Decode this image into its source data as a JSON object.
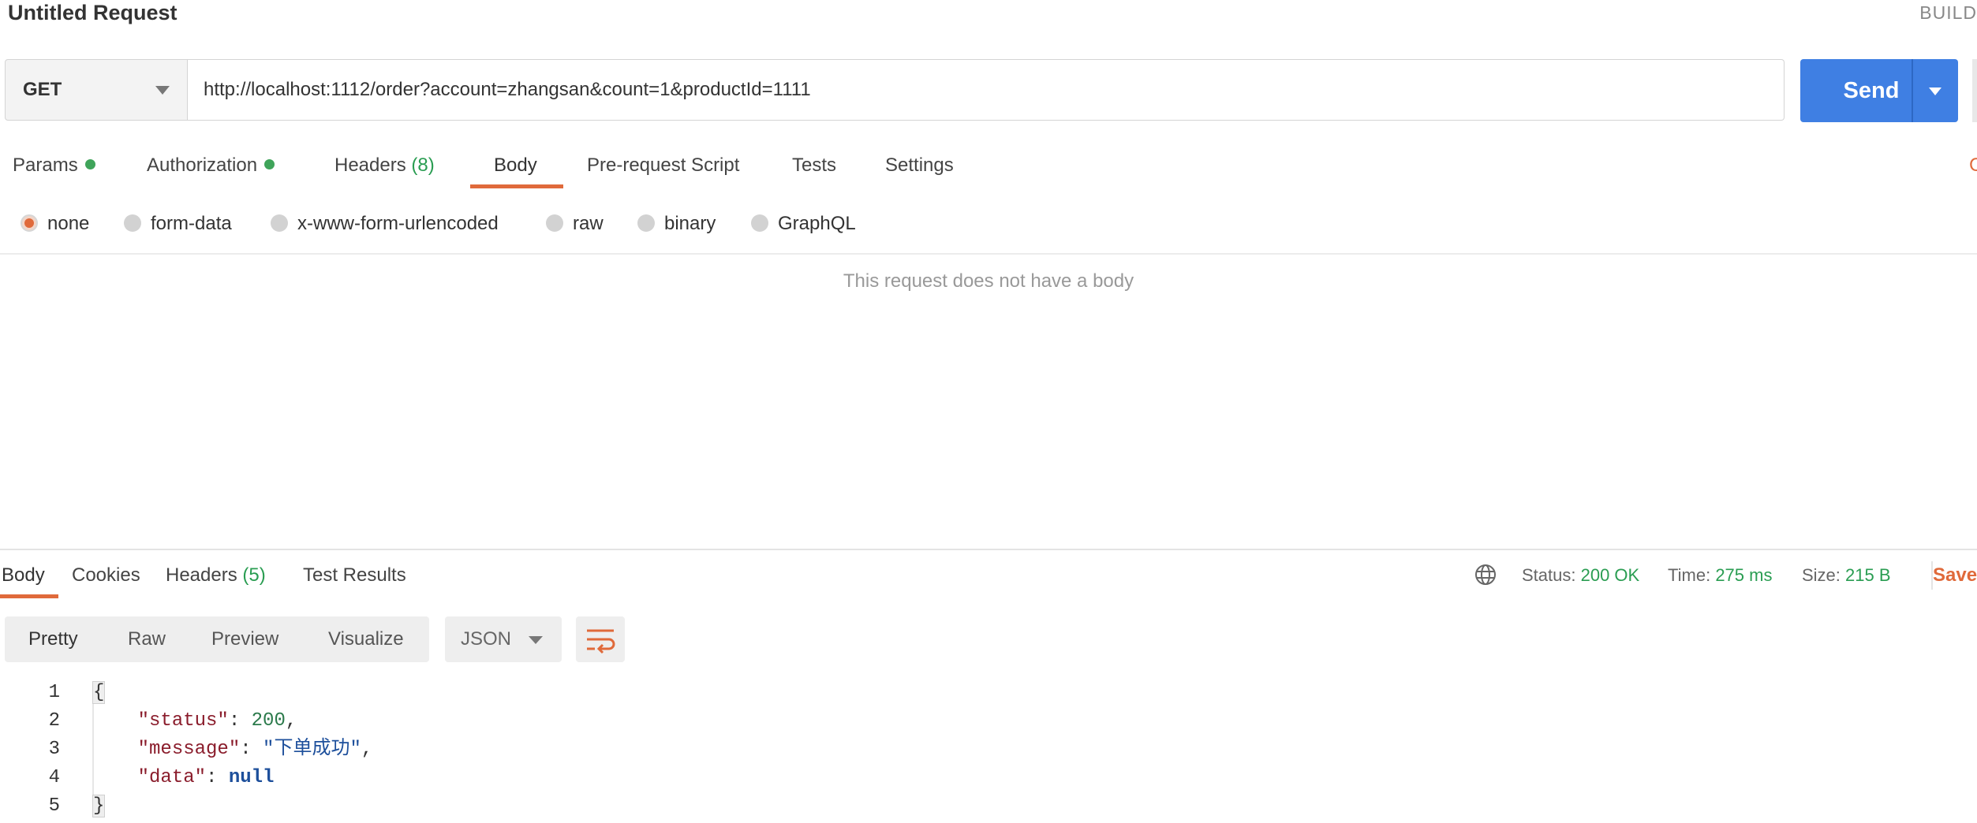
{
  "header": {
    "title": "Untitled Request",
    "build_label": "BUILD"
  },
  "request": {
    "method": "GET",
    "url": "http://localhost:1112/order?account=zhangsan&count=1&productId=1111",
    "send_label": "Send"
  },
  "tabs": {
    "params": "Params",
    "authorization": "Authorization",
    "headers": "Headers",
    "headers_count": "(8)",
    "body": "Body",
    "prerequest": "Pre-request Script",
    "tests": "Tests",
    "settings": "Settings",
    "edge_char": "C",
    "active": "Body"
  },
  "body_types": {
    "none": "none",
    "form_data": "form-data",
    "urlencoded": "x-www-form-urlencoded",
    "raw": "raw",
    "binary": "binary",
    "graphql": "GraphQL",
    "selected": "none"
  },
  "no_body_message": "This request does not have a body",
  "response": {
    "tabs": {
      "body": "Body",
      "cookies": "Cookies",
      "headers": "Headers",
      "headers_count": "(5)",
      "test_results": "Test Results",
      "active": "Body"
    },
    "status_label": "Status:",
    "status_value": "200 OK",
    "time_label": "Time:",
    "time_value": "275 ms",
    "size_label": "Size:",
    "size_value": "215 B",
    "save_label": "Save",
    "view_modes": {
      "pretty": "Pretty",
      "raw": "Raw",
      "preview": "Preview",
      "visualize": "Visualize",
      "active": "Pretty"
    },
    "format": "JSON",
    "code": {
      "line_numbers": [
        "1",
        "2",
        "3",
        "4",
        "5"
      ],
      "open_brace": "{",
      "close_brace": "}",
      "status_key": "\"status\"",
      "status_value": "200",
      "message_key": "\"message\"",
      "message_value": "\"下单成功\"",
      "data_key": "\"data\"",
      "data_value": "null"
    }
  },
  "colors": {
    "accent": "#e06a3b",
    "send_blue": "#3f7fe3",
    "status_green": "#2a9d52",
    "indicator_dot": "#3fa45a"
  },
  "icons": {
    "method_caret": "chevron-down-icon",
    "send_caret": "chevron-down-icon",
    "globe": "globe-icon",
    "wrap": "wrap-lines-icon"
  }
}
